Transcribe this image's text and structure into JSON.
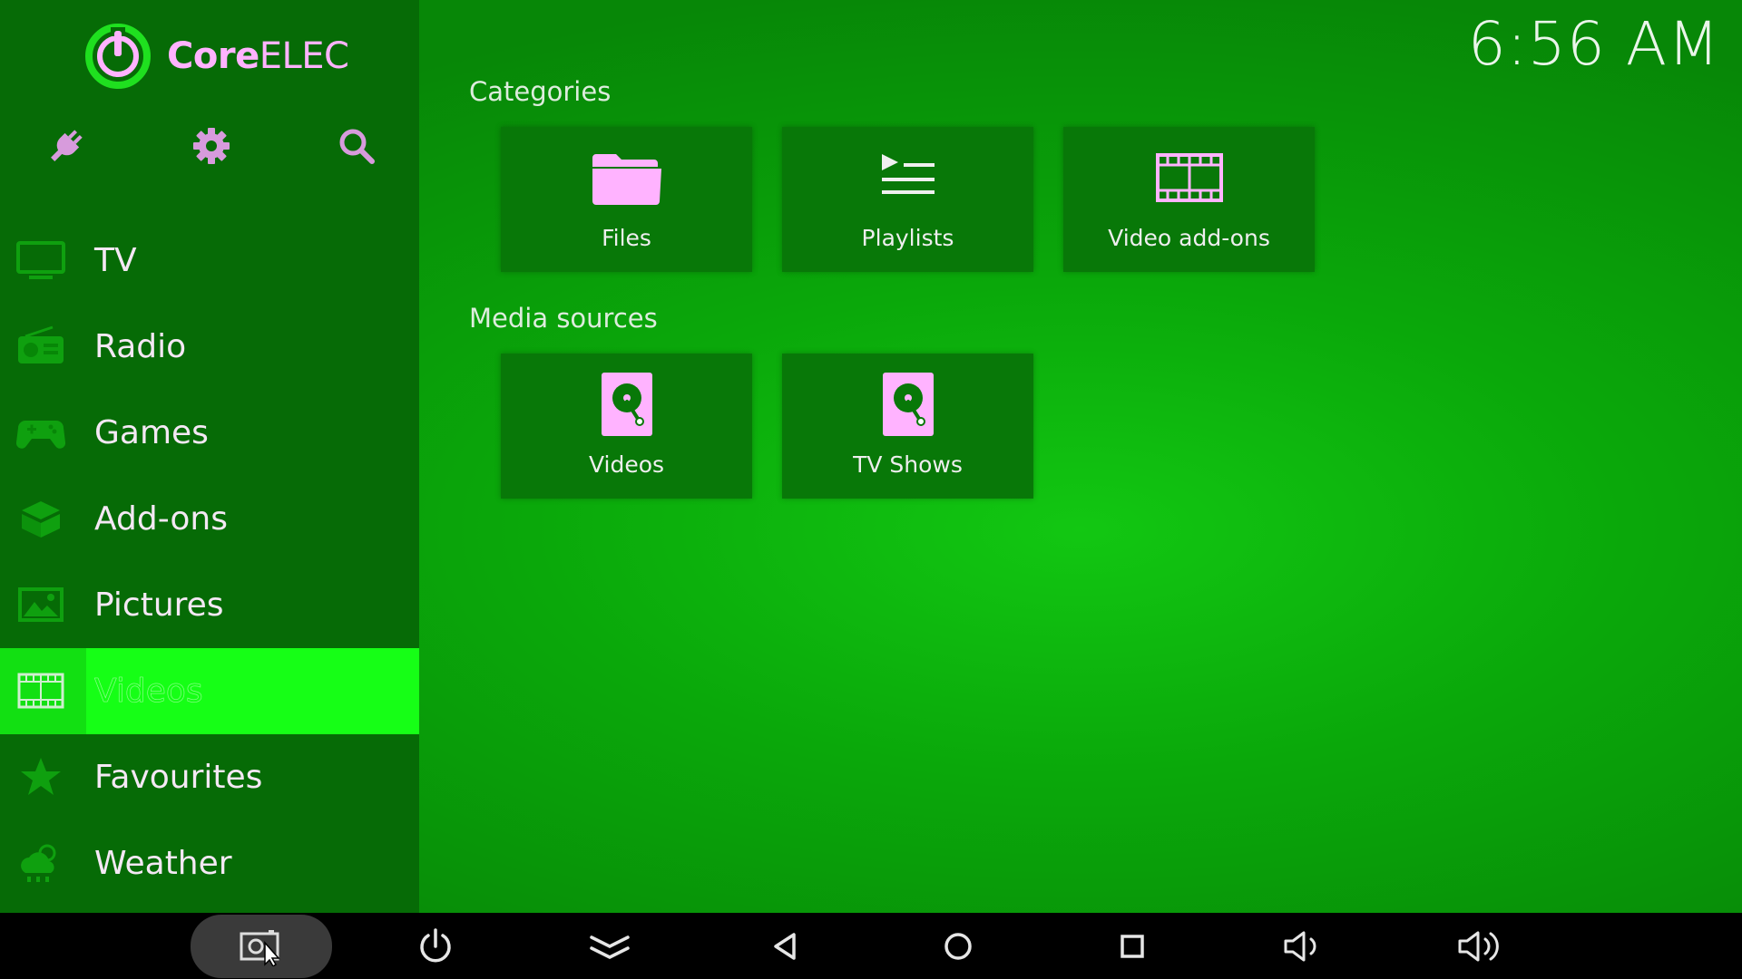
{
  "app": {
    "brand_prefix": "Core",
    "brand_suffix": "ELEC",
    "clock": "6:56 AM"
  },
  "top_icons": [
    {
      "name": "power-plug-icon"
    },
    {
      "name": "gear-icon"
    },
    {
      "name": "search-icon"
    }
  ],
  "menu": {
    "items": [
      {
        "label": "TV",
        "icon": "tv-icon"
      },
      {
        "label": "Radio",
        "icon": "radio-icon"
      },
      {
        "label": "Games",
        "icon": "gamepad-icon"
      },
      {
        "label": "Add-ons",
        "icon": "addons-box-icon"
      },
      {
        "label": "Pictures",
        "icon": "picture-icon"
      },
      {
        "label": "Videos",
        "icon": "film-icon",
        "active": true
      },
      {
        "label": "Favourites",
        "icon": "star-icon"
      },
      {
        "label": "Weather",
        "icon": "weather-cloud-icon"
      }
    ]
  },
  "sections": {
    "categories": {
      "title": "Categories",
      "tiles": [
        {
          "label": "Files",
          "icon": "folder-icon"
        },
        {
          "label": "Playlists",
          "icon": "playlist-icon"
        },
        {
          "label": "Video add-ons",
          "icon": "film-icon"
        }
      ]
    },
    "media_sources": {
      "title": "Media sources",
      "tiles": [
        {
          "label": "Videos",
          "icon": "hard-drive-icon"
        },
        {
          "label": "TV Shows",
          "icon": "hard-drive-icon"
        }
      ]
    }
  },
  "navbar": {
    "buttons": [
      {
        "name": "screenshot-icon"
      },
      {
        "name": "power-icon"
      },
      {
        "name": "chevron-double-down-icon"
      },
      {
        "name": "back-triangle-icon"
      },
      {
        "name": "home-circle-icon"
      },
      {
        "name": "recents-square-icon"
      },
      {
        "name": "volume-down-icon"
      },
      {
        "name": "volume-up-icon"
      }
    ]
  },
  "colors": {
    "accent_pink": "#ffb3ff",
    "sidebar_bg": "#066b06",
    "active_item": "#16ff16",
    "logo_green": "#1fe01f",
    "tile_bg": "#087808"
  }
}
